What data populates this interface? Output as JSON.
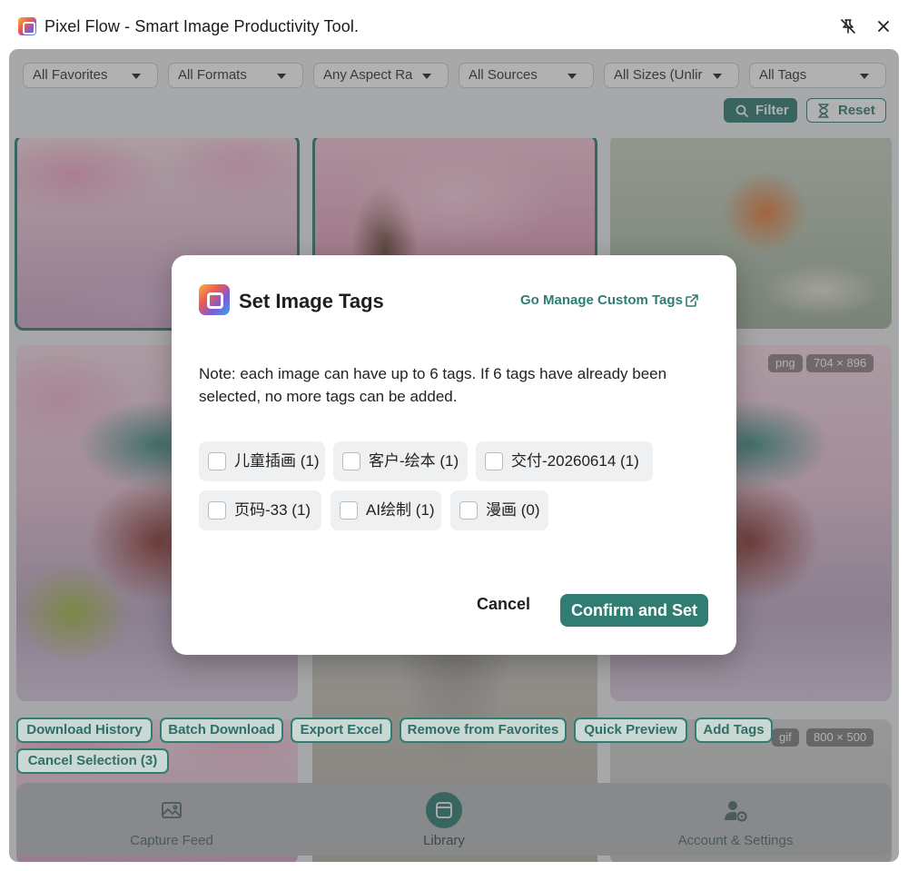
{
  "window": {
    "title": "Pixel Flow - Smart Image Productivity Tool."
  },
  "filters": {
    "favorites": "All Favorites",
    "formats": "All Formats",
    "aspect": "Any Aspect Ra",
    "sources": "All Sources",
    "sizes": "All Sizes (Unlir",
    "tags": "All Tags",
    "filter_label": "Filter",
    "reset_label": "Reset"
  },
  "gallery": {
    "tile_top_right_badges": {
      "format": "png",
      "size": "704 × 896"
    },
    "tile_bottom_right_badges": {
      "format": "gif",
      "size": "800 × 500"
    }
  },
  "actions": {
    "download_history": "Download History",
    "batch_download": "Batch Download",
    "export_excel": "Export Excel",
    "remove_favorites": "Remove from Favorites",
    "quick_preview": "Quick Preview",
    "add_tags": "Add Tags",
    "cancel_selection": "Cancel Selection (3)"
  },
  "nav": {
    "capture": "Capture Feed",
    "library": "Library",
    "account": "Account & Settings"
  },
  "modal": {
    "title": "Set Image Tags",
    "manage_link": "Go Manage Custom Tags",
    "note": "Note: each image can have up to 6 tags. If 6 tags have already been selected, no more tags can be added.",
    "tags": [
      {
        "label": "儿童插画 (1)",
        "checked": false
      },
      {
        "label": "客户-绘本 (1)",
        "checked": false
      },
      {
        "label": "交付-20260614 (1)",
        "checked": false
      },
      {
        "label": "页码-33 (1)",
        "checked": false
      },
      {
        "label": "AI绘制 (1)",
        "checked": false
      },
      {
        "label": "漫画 (0)",
        "checked": false
      }
    ],
    "cancel_label": "Cancel",
    "confirm_label": "Confirm and Set"
  },
  "colors": {
    "accent": "#2f7d73",
    "overlay": "#464646"
  }
}
